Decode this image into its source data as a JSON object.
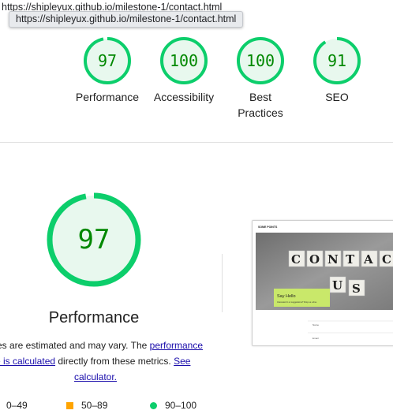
{
  "url": "https://shipleyux.github.io/milestone-1/contact.html",
  "tooltip": "https://shipleyux.github.io/milestone-1/contact.html",
  "colors": {
    "pass": "#0cce6b",
    "pass_text": "#008800",
    "pass_bg": "#e8f8ee",
    "average": "#ffa400",
    "fail": "#ff4e42",
    "link": "#1a0dab"
  },
  "scores": [
    {
      "value": "97",
      "label": "Performance"
    },
    {
      "value": "100",
      "label": "Accessibility"
    },
    {
      "value": "100",
      "label": "Best Practices"
    },
    {
      "value": "91",
      "label": "SEO"
    }
  ],
  "performance": {
    "score": "97",
    "title": "Performance",
    "desc_1": "es are estimated and may vary. The ",
    "desc_link_1a": "performance",
    "desc_link_1b": "re is calculated",
    "desc_2": " directly from these metrics. ",
    "desc_link_2a": "See",
    "desc_link_2b": "calculator."
  },
  "legend": [
    {
      "range": "0–49",
      "shape": "triangle"
    },
    {
      "range": "50–89",
      "shape": "square"
    },
    {
      "range": "90–100",
      "shape": "circle"
    }
  ],
  "screenshot": {
    "logo": "SOME POINTS",
    "tiles_row1": [
      "C",
      "O",
      "N",
      "T",
      "A",
      "C"
    ],
    "tiles_row2": [
      "U",
      "S"
    ],
    "hello_title": "Say Hello",
    "hello_sub": "Interested in or suggestions? Drop us a line.",
    "field_1": "Name",
    "field_2": "Email"
  }
}
